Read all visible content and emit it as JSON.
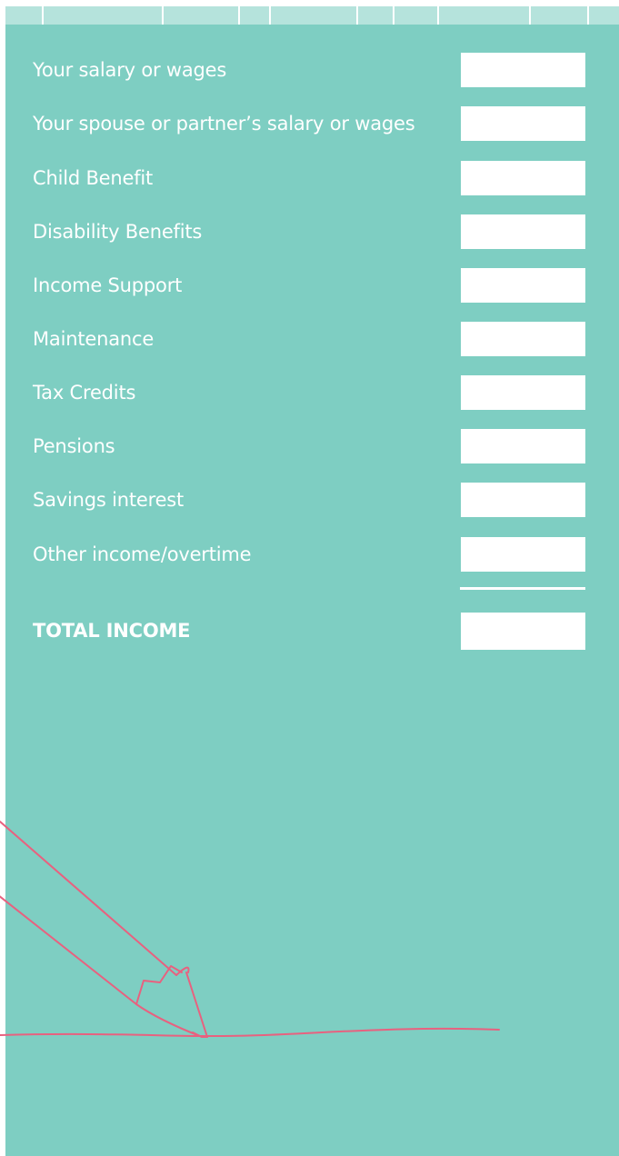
{
  "income_form": {
    "rows": [
      {
        "label": "Your salary or wages",
        "value": ""
      },
      {
        "label": "Your spouse or partner’s salary or wages",
        "value": ""
      },
      {
        "label": "Child Benefit",
        "value": ""
      },
      {
        "label": "Disability Benefits",
        "value": ""
      },
      {
        "label": "Income Support",
        "value": ""
      },
      {
        "label": "Maintenance",
        "value": ""
      },
      {
        "label": "Tax Credits",
        "value": ""
      },
      {
        "label": "Pensions",
        "value": ""
      },
      {
        "label": "Savings interest",
        "value": ""
      },
      {
        "label": "Other income/overtime",
        "value": ""
      }
    ],
    "total": {
      "label": "TOTAL INCOME",
      "value": ""
    }
  },
  "colors": {
    "panel": "#7ecec2",
    "strip": "#b5e3dc",
    "text": "#ffffff",
    "pencil_line": "#e8617f"
  },
  "icons": {
    "decoration": "pencil-icon"
  }
}
